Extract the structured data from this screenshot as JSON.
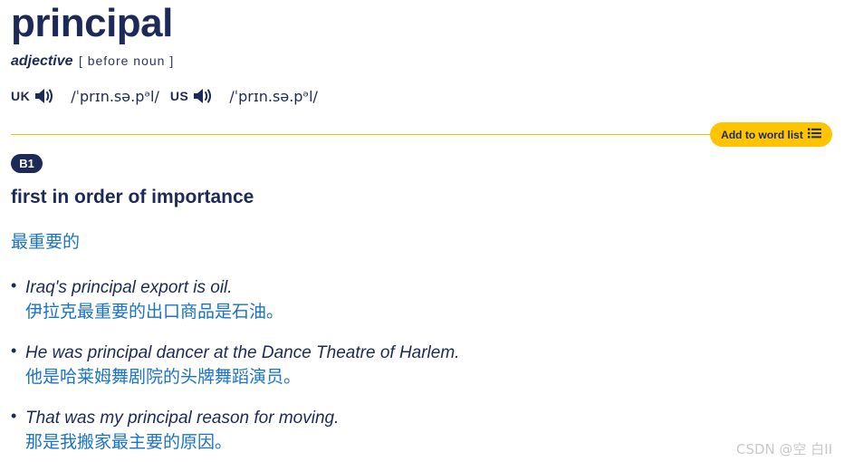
{
  "entry": {
    "headword": "principal",
    "part_of_speech": "adjective",
    "grammar": "[ before noun ]"
  },
  "pronunciation": {
    "uk_label": "UK",
    "uk_ipa": "/ˈprɪn.sə.pᵊl/",
    "us_label": "US",
    "us_ipa": "/ˈprɪn.sə.pᵊl/"
  },
  "toolbar": {
    "add_to_word_list": "Add to word list"
  },
  "sense": {
    "level": "B1",
    "definition": "first in order of importance",
    "translation": "最重要的"
  },
  "examples": [
    {
      "en": "Iraq's principal export is oil.",
      "zh": "伊拉克最重要的出口商品是石油。"
    },
    {
      "en": "He was principal dancer at the Dance Theatre of Harlem.",
      "zh": "他是哈莱姆舞剧院的头牌舞蹈演员。"
    },
    {
      "en": "That was my principal reason for moving.",
      "zh": "那是我搬家最主要的原因。"
    }
  ],
  "watermark": "CSDN @空 白II",
  "colors": {
    "brand_navy": "#1d2a57",
    "accent_yellow": "#fec400",
    "translation_blue": "#1a73c8"
  },
  "icons": {
    "audio": "speaker-icon",
    "list": "list-icon"
  }
}
